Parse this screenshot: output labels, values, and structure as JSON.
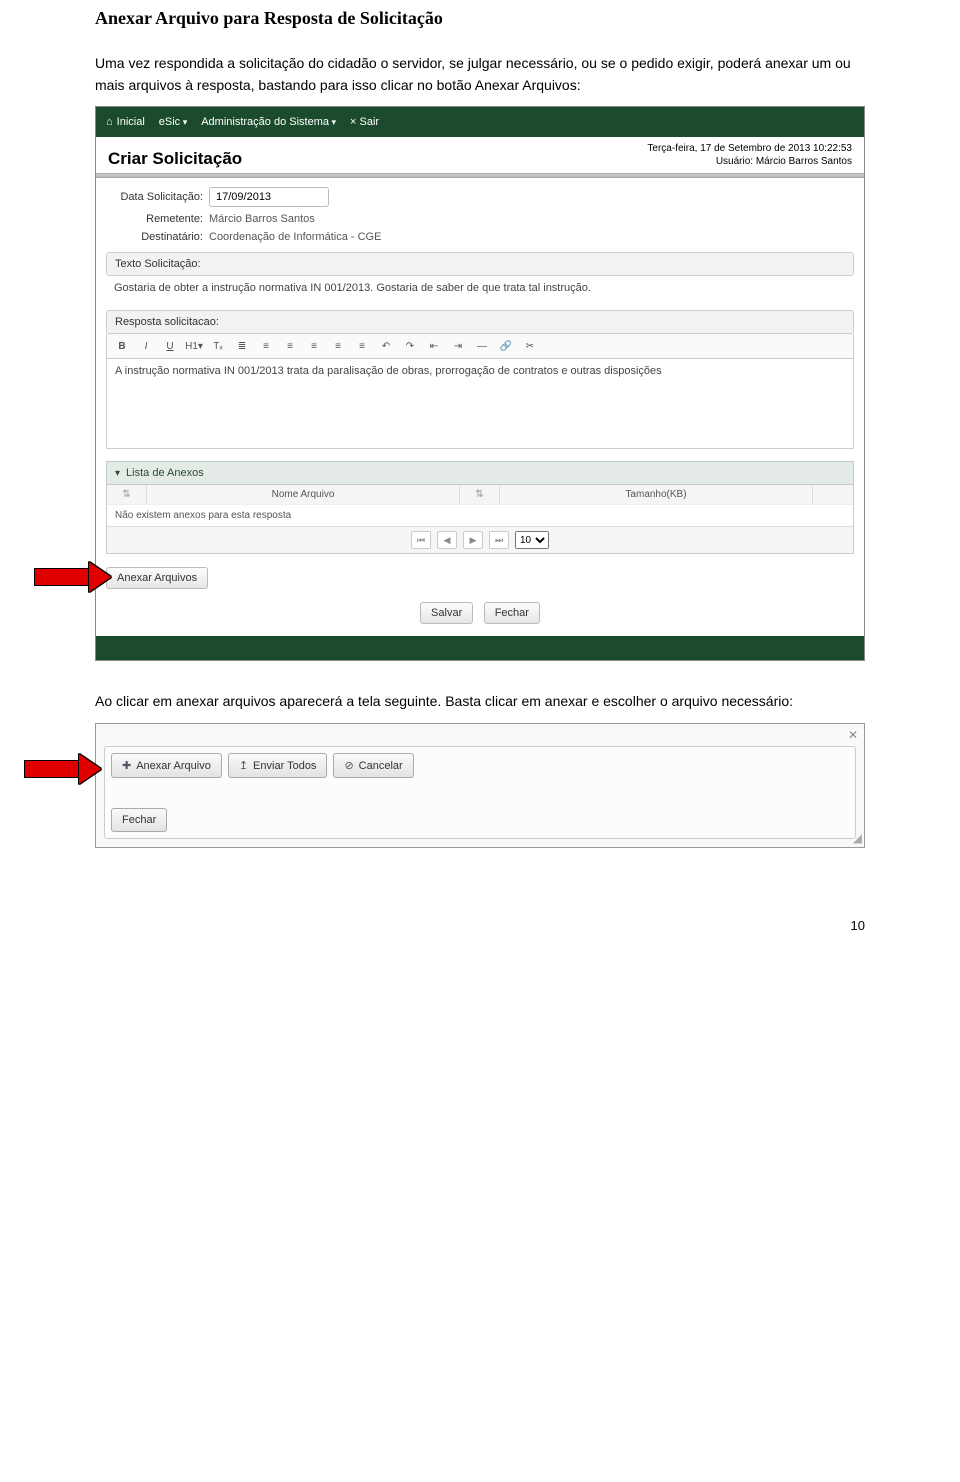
{
  "doc": {
    "title": "Anexar Arquivo para Resposta de Solicitação",
    "p1": "Uma vez respondida a solicitação do cidadão o servidor, se julgar necessário, ou se o pedido exigir, poderá anexar um ou mais arquivos à resposta, bastando para isso clicar no botão Anexar Arquivos:",
    "p2": "Ao clicar em anexar arquivos aparecerá a tela seguinte. Basta clicar em anexar e escolher o arquivo necessário:",
    "page_num": "10"
  },
  "nav": {
    "inicial": "Inicial",
    "esic": "eSic",
    "admin": "Administração do Sistema",
    "sair": "Sair"
  },
  "header": {
    "title": "Criar Solicitação",
    "datetime": "Terça-feira, 17 de Setembro de 2013 10:22:53",
    "user_line": "Usuário: Márcio Barros Santos"
  },
  "form": {
    "data_label": "Data Solicitação:",
    "data_value": "17/09/2013",
    "rem_label": "Remetente:",
    "rem_value": "Márcio Barros Santos",
    "dest_label": "Destinatário:",
    "dest_value": "Coordenação de Informática - CGE"
  },
  "texto": {
    "head": "Texto Solicitação:",
    "body": "Gostaria de obter a instrução normativa IN 001/2013. Gostaria de saber de que trata tal instrução."
  },
  "resposta": {
    "head": "Resposta solicitacao:",
    "body": "A instrução normativa IN 001/2013 trata da paralisação de obras, prorrogação de contratos e outras disposições"
  },
  "tb": {
    "b": "B",
    "i": "I",
    "u": "U",
    "h": "H1▾",
    "tx": "Tₓ"
  },
  "anexos": {
    "head": "Lista de Anexos",
    "col_nome": "Nome Arquivo",
    "col_tam": "Tamanho(KB)",
    "empty": "Não existem anexos para esta resposta",
    "pg_first": "⏮",
    "pg_prev": "◀",
    "pg_next": "▶",
    "pg_last": "⏭",
    "pg_size": "10"
  },
  "buttons": {
    "anexar": "Anexar Arquivos",
    "salvar": "Salvar",
    "fechar": "Fechar"
  },
  "dialog": {
    "anexar": "Anexar Arquivo",
    "enviar": "Enviar Todos",
    "cancelar": "Cancelar",
    "fechar": "Fechar",
    "icon_plus": "✚",
    "icon_up": "↥",
    "icon_cancel": "⊘"
  }
}
